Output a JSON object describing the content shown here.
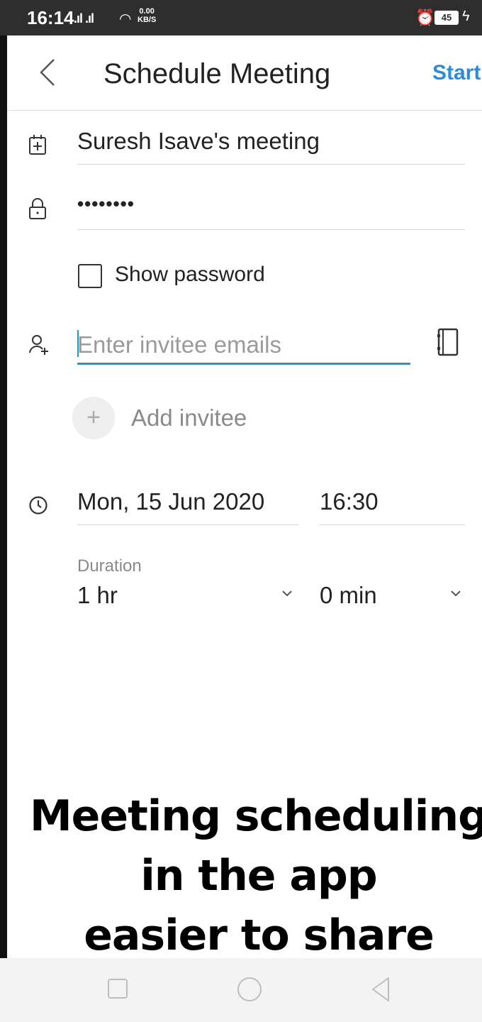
{
  "status_bar": {
    "time": "16:14",
    "signal": ".ıl .ıl",
    "net_speed_value": "0.00",
    "net_speed_unit": "KB/S",
    "battery": "45"
  },
  "header": {
    "title": "Schedule Meeting",
    "start_label": "Start"
  },
  "form": {
    "topic_value": "Suresh Isave's meeting",
    "password_value": "••••••••",
    "show_password_label": "Show password",
    "invitee_placeholder": "Enter invitee emails",
    "add_invitee_label": "Add invitee",
    "date_value": "Mon, 15 Jun 2020",
    "time_value": "16:30",
    "duration_label": "Duration",
    "duration_hours": "1 hr",
    "duration_minutes": "0 min"
  },
  "promo": {
    "line1": "Meeting scheduling",
    "line2": "in the app",
    "line3": "easier to share"
  },
  "colors": {
    "accent": "#2d8cd6",
    "input_focus": "#2b95c2",
    "status_bar": "#2e2e2e"
  }
}
